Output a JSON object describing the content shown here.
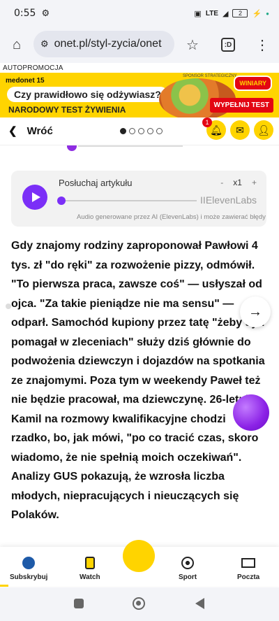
{
  "status_bar": {
    "time": "0:55",
    "network": "LTE",
    "battery": "2"
  },
  "browser": {
    "url": "onet.pl/styl-zycia/onet",
    "tab_count": ":D"
  },
  "ad": {
    "label": "AUTOPROMOCJA",
    "logo": "medonet 15",
    "question": "Czy prawidłowo się odżywiasz?",
    "subtitle": "NARODOWY TEST ŻYWIENIA",
    "sponsor": "SPONSOR STRATEGICZNY",
    "brand": "WINIARY",
    "cta": "WYPEŁNIJ TEST"
  },
  "nav": {
    "back_label": "Wróć",
    "pager_dots": 5,
    "active_dot": 0,
    "notification_count": "1"
  },
  "player": {
    "title": "Posłuchaj artykułu",
    "minus": "-",
    "speed": "x1",
    "plus": "+",
    "provider": "IIElevenLabs",
    "disclaimer": "Audio generowane przez AI (ElevenLabs) i może zawierać błędy"
  },
  "article": {
    "text": "Gdy znajomy rodziny zaproponował Pawłowi 4 tys. zł \"do ręki\" za rozwożenie pizzy, odmówił. \"To pierwsza praca, zawsze coś\" — usłyszał od ojca. \"Za takie pieniądze nie ma sensu\" — odparł. Samochód kupiony przez tatę \"żeby syn pomagał w zleceniach\" służy dziś głównie do podwożenia dziewczyn i dojazdów na spotkania ze znajomymi. Poza tym w weekendy Paweł też nie będzie pracował, ma dziewczynę. 26-letni Kamil na rozmowy kwalifikacyjne chodzi rzadko, bo, jak mówi, \"po co tracić czas, skoro wiadomo, że nie spełnią moich oczekiwań\". Analizy GUS pokazują, że wzrosła liczba młodych, niepracujących i nieuczących się Polaków."
  },
  "bottom_nav": {
    "items": [
      {
        "label": "Subskrybuj",
        "icon": "globe-icon"
      },
      {
        "label": "Watch",
        "icon": "watch-icon"
      },
      {
        "label": "",
        "icon": "yellow-circle-icon"
      },
      {
        "label": "Sport",
        "icon": "soccer-ball-icon"
      },
      {
        "label": "Poczta",
        "icon": "mail-icon"
      }
    ]
  },
  "colors": {
    "accent": "#ffd400",
    "player_purple": "#7b2ff7",
    "ad_red": "#e30613"
  }
}
